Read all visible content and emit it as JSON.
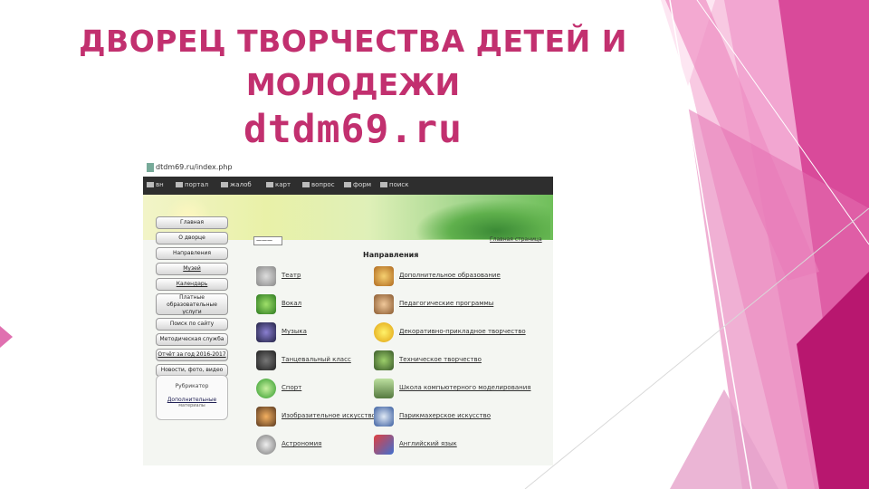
{
  "slide": {
    "title_line1": "ДВОРЕЦ ТВОРЧЕСТВА ДЕТЕЙ И",
    "title_line2": "МОЛОДЕЖИ",
    "site": "dtdm69.ru",
    "colors": {
      "accent": "#c2306f",
      "pink_dark": "#b0196e",
      "pink_mid": "#e066a8",
      "pink_light": "#f7b8dc"
    }
  },
  "browser": {
    "address": "dtdm69.ru/index.php",
    "nav": [
      "вн",
      "портал",
      "жалоб",
      "карт",
      "вопрос",
      "форм",
      "поиск"
    ]
  },
  "site_page": {
    "sidebar": [
      "Главная",
      "О дворце",
      "Направления",
      "Музей",
      "Календарь",
      "Платные образовательные услуги",
      "Поиск по сайту",
      "Методическая служба",
      "Отчёт за год 2016-2017",
      "Новости, фото, видео"
    ],
    "sidebar_box": {
      "title": "Рубрикатор",
      "link": "Дополнительные",
      "note": "материалы"
    },
    "select_value": "———",
    "top_link": "Главная страница",
    "heading": "Направления",
    "directions_left": [
      {
        "label": "Театр",
        "icon": "theatre-icon"
      },
      {
        "label": "Вокал",
        "icon": "microphone-icon"
      },
      {
        "label": "Музыка",
        "icon": "music-icon"
      },
      {
        "label": "Танцевальный класс",
        "icon": "speaker-icon"
      },
      {
        "label": "Спорт",
        "icon": "sport-icon"
      },
      {
        "label": "Изобразительное искусство",
        "icon": "art-icon"
      },
      {
        "label": "Астрономия",
        "icon": "planet-icon"
      }
    ],
    "directions_right": [
      {
        "label": "Дополнительное образование",
        "icon": "people-icon"
      },
      {
        "label": "Педагогические программы",
        "icon": "kids-icon"
      },
      {
        "label": "Декоративно-прикладное творчество",
        "icon": "flower-icon"
      },
      {
        "label": "Техническое творчество",
        "icon": "tech-icon"
      },
      {
        "label": "Школа компьютерного моделирования",
        "icon": "computer-icon"
      },
      {
        "label": "Парикмахерское искусство",
        "icon": "scissors-icon"
      },
      {
        "label": "Английский язык",
        "icon": "language-icon"
      }
    ]
  }
}
